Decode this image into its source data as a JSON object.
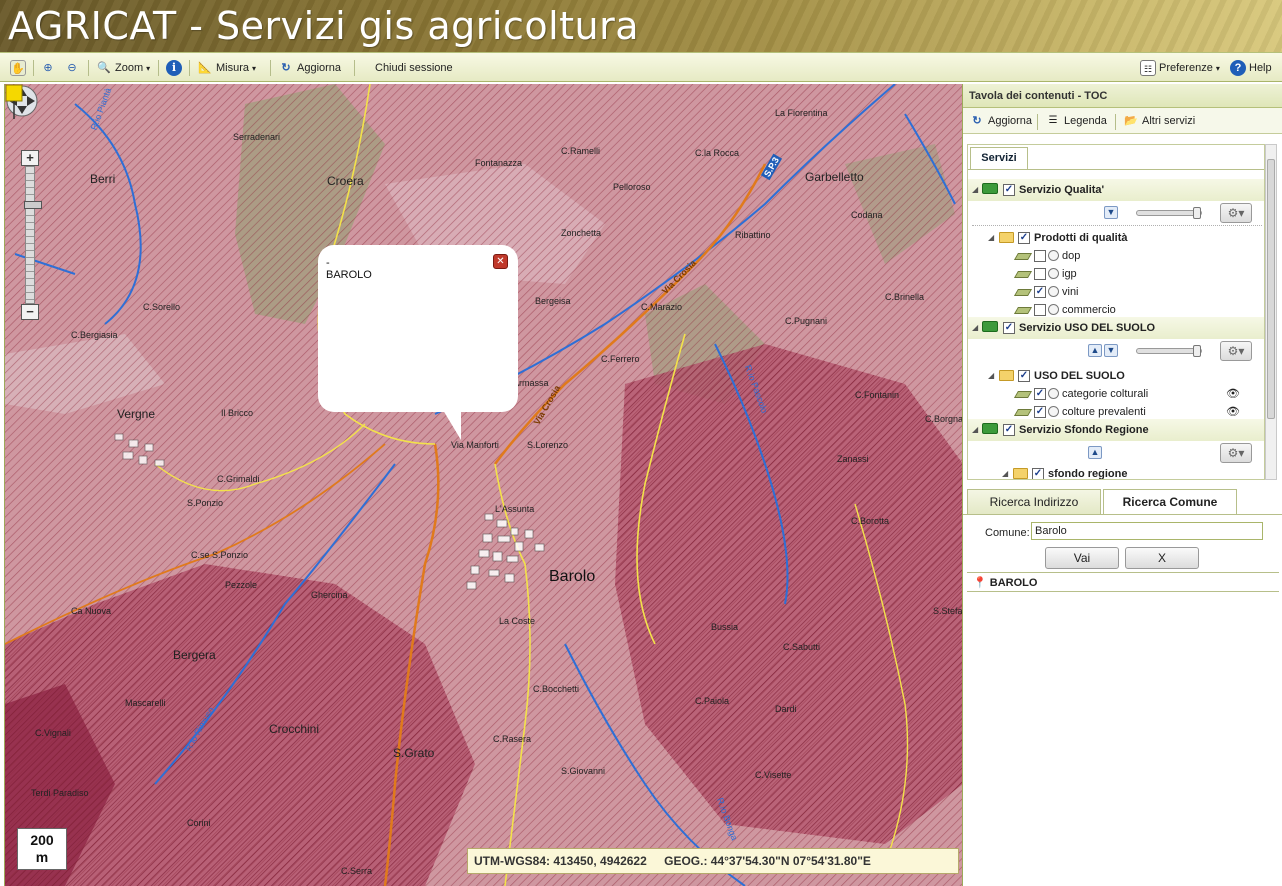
{
  "header": {
    "title": "AGRICAT - Servizi gis agricoltura"
  },
  "toolbar": {
    "zoom_label": "Zoom",
    "misura_label": "Misura",
    "aggiorna_label": "Aggiorna",
    "chiudi_label": "Chiudi sessione",
    "preferenze_label": "Preferenze",
    "help_label": "Help"
  },
  "map": {
    "popup_dash": "-",
    "popup_text": "BAROLO",
    "scale_value": "200",
    "scale_unit": "m",
    "coords": {
      "utm": "UTM-WGS84: 413450, 4942622",
      "geog": "GEOG.: 44°37'54.30\"N   07°54'31.80\"E"
    },
    "road_label": "S.P.3",
    "places": [
      "Berri",
      "Serradenari",
      "Croera",
      "Fontanazza",
      "C.Ramelli",
      "C.la Rocca",
      "La Fiorentina",
      "Garbelletto",
      "Pelloroso",
      "Zonchetta",
      "Ribattino",
      "Codana",
      "C.Sorello",
      "C.Bergiasia",
      "Bergeisa",
      "C.Marazio",
      "C.Pugnani",
      "C.Brinella",
      "C.Ferrero",
      "Vergne",
      "Il Bricco",
      "Via Manforti",
      "S.Lorenzo",
      "C.Fontanin",
      "C.Grimaldi",
      "S.Ponzio",
      "L'Assunta",
      "Barolo",
      "C.se S.Ponzio",
      "Pezzole",
      "Ghercina",
      "Ca Nuova",
      "Bergera",
      "La Coste",
      "Bussia",
      "C.Sabutti",
      "Mascarelli",
      "Crocchini",
      "S.Grato",
      "C.Bocchetti",
      "C.Paiola",
      "Dardi",
      "C.Rasera",
      "S.Giovanni",
      "C.Visette",
      "Corini",
      "Terdi Paradiso",
      "C.Vignali",
      "C.Serra",
      "Zanassi",
      "C.Borotta",
      "S.Stefanino",
      "Armassa",
      "Via Crosia",
      "C.Borgna"
    ],
    "stream_labels": [
      "R.io Piantà",
      "R.io Pascolo",
      "R.io Rimuso",
      "R.io Bonga"
    ]
  },
  "toc": {
    "title": "Tavola dei contenuti - TOC",
    "tools": {
      "aggiorna": "Aggiorna",
      "legenda": "Legenda",
      "altri": "Altri servizi"
    },
    "tab": "Servizi",
    "services": [
      {
        "name": "Servizio Qualita'",
        "group": "Prodotti di qualità",
        "layers": [
          {
            "name": "dop",
            "checked": false
          },
          {
            "name": "igp",
            "checked": false
          },
          {
            "name": "vini",
            "checked": true
          },
          {
            "name": "commercio",
            "checked": false
          }
        ]
      },
      {
        "name": "Servizio USO DEL SUOLO",
        "group": "USO DEL SUOLO",
        "layers": [
          {
            "name": "categorie colturali",
            "checked": true
          },
          {
            "name": "colture prevalenti",
            "checked": true
          }
        ]
      },
      {
        "name": "Servizio Sfondo Regione",
        "group": "sfondo regione",
        "layers": []
      }
    ]
  },
  "search": {
    "tabs": [
      "Ricerca Indirizzo",
      "Ricerca Comune"
    ],
    "active_tab": "Ricerca Comune",
    "comune_label": "Comune:",
    "comune_value": "Barolo",
    "vai_label": "Vai",
    "x_label": "X",
    "result": "BAROLO"
  },
  "colors": {
    "map_base": "#c98a95",
    "hatch": "#8e2a3c",
    "river": "#2e6fd6",
    "road_orange": "#e07a1c",
    "road_yellow": "#f3e24a",
    "forest": "#8fa070",
    "header": "#8a7634",
    "toolbar": "#e6eac4"
  }
}
